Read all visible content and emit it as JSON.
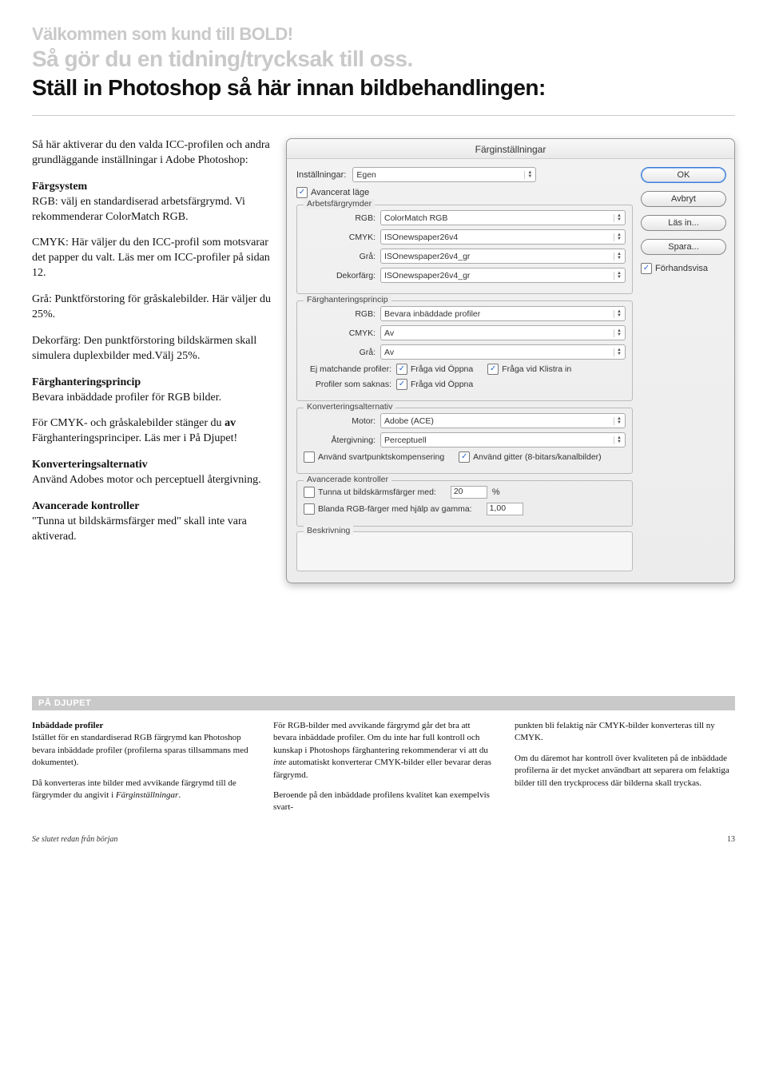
{
  "header": {
    "line1": "Välkommen som kund till BOLD!",
    "line2": "Så gör du en tidning/trycksak till oss.",
    "line3": "Ställ in Photoshop så här innan bildbehandlingen:"
  },
  "left": {
    "p1": "Så här aktiverar du den valda ICC-profilen och andra grundläggande inställningar i Adobe Photoshop:",
    "h1": "Färgsystem",
    "p2": "RGB: välj en standardiserad arbetsfärgrymd. Vi rekommenderar ColorMatch RGB.",
    "p3": "CMYK: Här väljer du den ICC-profil som motsvarar det papper du valt. Läs mer om ICC-profiler på sidan 12.",
    "p4": "Grå: Punktförstoring för gråskalebilder. Här väljer du 25%.",
    "p5": "Dekorfärg: Den punktförstoring bildskärmen skall simulera duplexbilder med.Välj 25%.",
    "h2": "Färghanteringsprincip",
    "p6": "Bevara inbäddade profiler för RGB bilder.",
    "p7a": "För CMYK- och gråskalebilder stänger du ",
    "p7b": "av",
    "p7c": "Färghanteringsprinciper. Läs mer i På Djupet!",
    "h3": "Konverteringsalternativ",
    "p8": "Använd Adobes motor och perceptuell återgivning.",
    "h4": "Avancerade kontroller",
    "p9": "\"Tunna ut bildskärmsfärger med\" skall inte vara aktiverad."
  },
  "dlg": {
    "title": "Färginställningar",
    "settings_lbl": "Inställningar:",
    "settings_val": "Egen",
    "adv_mode": "Avancerat läge",
    "ok": "OK",
    "cancel": "Avbryt",
    "load": "Läs in...",
    "save": "Spara...",
    "preview": "Förhandsvisa",
    "g1": "Arbetsfärgrymder",
    "rgb_l": "RGB:",
    "rgb_v": "ColorMatch RGB",
    "cmyk_l": "CMYK:",
    "cmyk_v": "ISOnewspaper26v4",
    "gray_l": "Grå:",
    "gray_v": "ISOnewspaper26v4_gr",
    "spot_l": "Dekorfärg:",
    "spot_v": "ISOnewspaper26v4_gr",
    "g2": "Färghanteringsprincip",
    "pol_rgb_v": "Bevara inbäddade profiler",
    "pol_cmyk_v": "Av",
    "pol_gray_v": "Av",
    "mm_l": "Ej matchande profiler:",
    "mm_open": "Fråga vid Öppna",
    "mm_paste": "Fråga vid Klistra in",
    "miss_l": "Profiler som saknas:",
    "miss_open": "Fråga vid Öppna",
    "g3": "Konverteringsalternativ",
    "engine_l": "Motor:",
    "engine_v": "Adobe (ACE)",
    "intent_l": "Återgivning:",
    "intent_v": "Perceptuell",
    "bpc": "Använd svartpunktskompensering",
    "dither": "Använd gitter (8-bitars/kanalbilder)",
    "g4": "Avancerade kontroller",
    "desat_l": "Tunna ut bildskärmsfärger med:",
    "desat_v": "20",
    "desat_u": "%",
    "blend_l": "Blanda RGB-färger med hjälp av gamma:",
    "blend_v": "1,00",
    "g5": "Beskrivning"
  },
  "footer": {
    "tag": "PÅ DJUPET",
    "c1h": "Inbäddade profiler",
    "c1a": "Istället för en standardiserad RGB färgrymd kan Photoshop bevara inbäddade profiler (profilerna sparas tillsammans med dokumentet).",
    "c1b_a": "Då konverteras inte bilder med avvikande färgrymd till de färgrymder du angivit i ",
    "c1b_i": "Färginställningar",
    "c1b_b": ".",
    "c2a_a": "För RGB-bilder med avvikande färgrymd går det bra att bevara inbäddade profiler. Om du inte har full kontroll och kunskap i Photoshops färghantering rekommenderar vi att du ",
    "c2a_i": "inte",
    "c2a_b": " automatiskt konverterar CMYK-bilder eller bevarar deras färgrymd.",
    "c2b": "Beroende på den inbäddade profilens kvalitet kan exempelvis svart-",
    "c3a": "punkten bli felaktig när CMYK-bilder konverteras till ny CMYK.",
    "c3b": "Om du däremot har kontroll över kvaliteten på de inbäddade profilerna är det mycket användbart att separera om felaktiga bilder till den tryckprocess där bilderna skall tryckas.",
    "foot_l": "Se slutet redan från början",
    "foot_r": "13"
  }
}
